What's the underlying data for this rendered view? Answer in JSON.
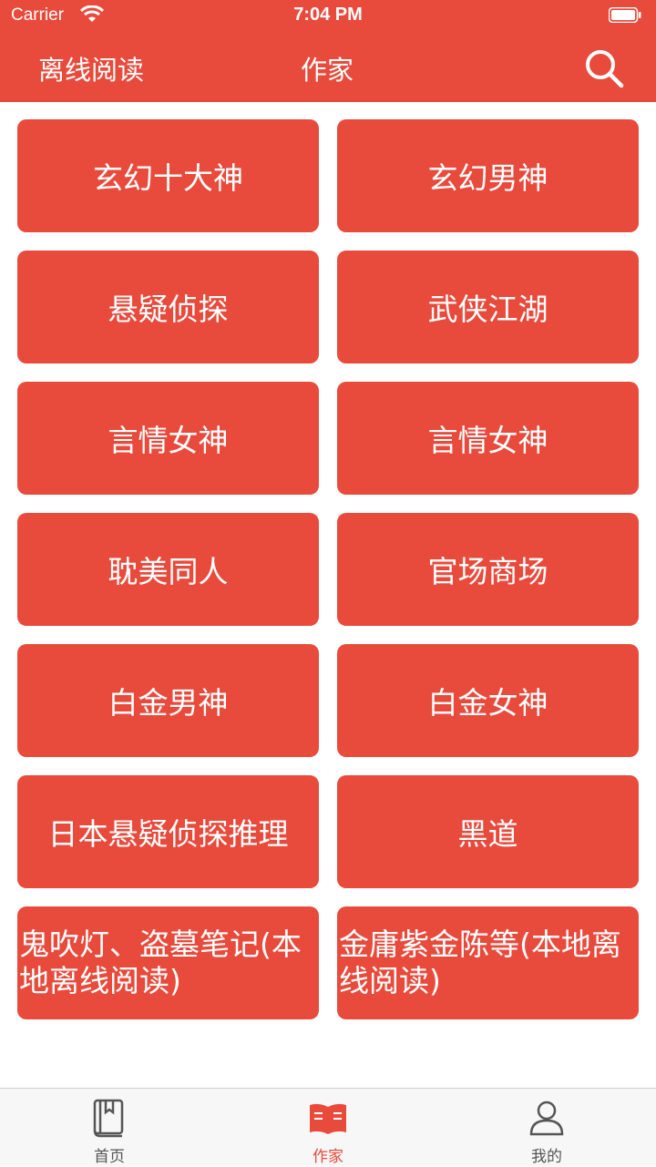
{
  "status_bar": {
    "carrier": "Carrier",
    "time": "7:04 PM"
  },
  "nav": {
    "left_label": "离线阅读",
    "title": "作家"
  },
  "categories": [
    "玄幻十大神",
    "玄幻男神",
    "悬疑侦探",
    "武侠江湖",
    "言情女神",
    "言情女神",
    "耽美同人",
    "官场商场",
    "白金男神",
    "白金女神",
    "日本悬疑侦探推理",
    "黑道",
    "鬼吹灯、盗墓笔记(本地离线阅读)",
    "金庸紫金陈等(本地离线阅读)"
  ],
  "tabs": [
    {
      "label": "首页",
      "icon": "book-icon",
      "active": false
    },
    {
      "label": "作家",
      "icon": "open-book-icon",
      "active": true
    },
    {
      "label": "我的",
      "icon": "person-icon",
      "active": false
    }
  ],
  "colors": {
    "accent": "#E84A3C",
    "tab_inactive": "#555555"
  }
}
